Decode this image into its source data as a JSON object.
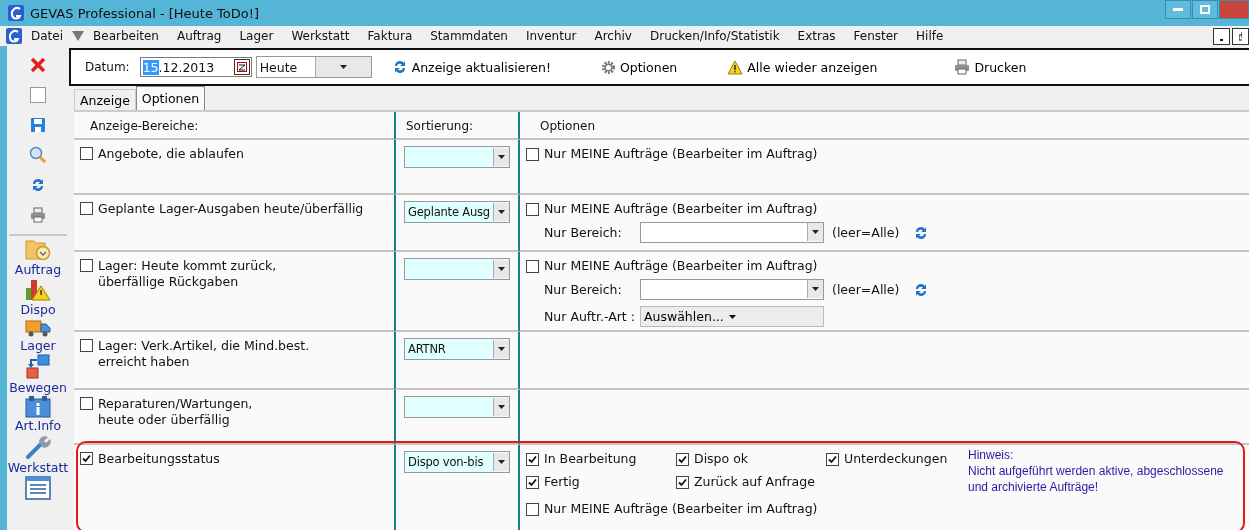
{
  "window": {
    "title": "GEVAS Professional - [Heute ToDo!]"
  },
  "menu": [
    "Datei",
    "Bearbeiten",
    "Auftrag",
    "Lager",
    "Werkstatt",
    "Faktura",
    "Stammdaten",
    "Inventur",
    "Archiv",
    "Drucken/Info/Statistik",
    "Extras",
    "Fenster",
    "Hilfe"
  ],
  "sidebar": {
    "items": [
      {
        "label": "Auftrag",
        "kind": "order"
      },
      {
        "label": "Dispo",
        "kind": "dispo"
      },
      {
        "label": "Lager",
        "kind": "stock"
      },
      {
        "label": "Bewegen",
        "kind": "move"
      },
      {
        "label": "Art.Info",
        "kind": "info"
      },
      {
        "label": "Werkstatt",
        "kind": "workshop"
      },
      {
        "kind": "list"
      }
    ]
  },
  "toolbar": {
    "date_label": "Datum:",
    "date": {
      "selected_text": "15",
      "rest": ".12.2013"
    },
    "period": "Heute",
    "buttons": [
      {
        "label": "Anzeige aktualisieren!",
        "kind": "refresh"
      },
      {
        "label": "Optionen",
        "kind": "gear"
      },
      {
        "label": "Alle wieder anzeigen",
        "kind": "warning"
      },
      {
        "label": "Drucken",
        "kind": "print"
      }
    ]
  },
  "tabs": [
    {
      "label": "Anzeige",
      "selected": false
    },
    {
      "label": "Optionen",
      "selected": true
    }
  ],
  "table": {
    "columns": [
      "Anzeige-Bereiche:",
      "Sortierung:",
      "Optionen"
    ],
    "rows": [
      {
        "label": "Angebote, die ablaufen",
        "checked": false,
        "options": [
          {
            "kind": "checkbox",
            "label": "Nur MEINE Aufträge (Bearbeiter im Auftrag)",
            "checked": false
          }
        ]
      },
      {
        "label": "Geplante Lager-Ausgaben heute/überfällig",
        "checked": false,
        "sort": "Geplante Ausg",
        "options": [
          {
            "kind": "checkbox",
            "label": "Nur MEINE Aufträge (Bearbeiter im Auftrag)",
            "checked": false
          },
          {
            "kind": "area",
            "label": "Nur Bereich:",
            "note": "(leer=Alle)"
          }
        ]
      },
      {
        "label": "Lager: Heute kommt zurück,\nüberfällige Rückgaben",
        "checked": false,
        "options": [
          {
            "kind": "checkbox",
            "label": "Nur MEINE Aufträge (Bearbeiter im Auftrag)",
            "checked": false
          },
          {
            "kind": "area",
            "label": "Nur Bereich:",
            "note": "(leer=Alle)"
          },
          {
            "kind": "type",
            "label": "Nur Auftr.-Art :",
            "button": "Auswählen..."
          }
        ]
      },
      {
        "label": "Lager: Verk.Artikel, die Mind.best.\nerreicht haben",
        "checked": false,
        "sort": "ARTNR",
        "options": []
      },
      {
        "label": "Reparaturen/Wartungen,\nheute oder überfällig",
        "checked": false,
        "options": []
      },
      {
        "label": "Bearbeitungsstatus",
        "checked": true,
        "sort": "Dispo von-bis",
        "highlighted": true,
        "options": [
          {
            "kind": "status",
            "items": [
              {
                "label": "In Bearbeitung",
                "checked": true
              },
              {
                "label": "Dispo ok",
                "checked": true
              },
              {
                "label": "Unterdeckungen",
                "checked": true
              },
              {
                "label": "Fertig",
                "checked": true
              },
              {
                "label": "Zurück auf Anfrage",
                "checked": true
              }
            ],
            "hint": {
              "title": "Hinweis:",
              "text": "Nicht aufgeführt werden aktive, abgeschlossene und archivierte Aufträge!"
            }
          },
          {
            "kind": "checkbox",
            "label": "Nur MEINE Aufträge (Bearbeiter im Auftrag)",
            "checked": false
          }
        ]
      }
    ]
  }
}
